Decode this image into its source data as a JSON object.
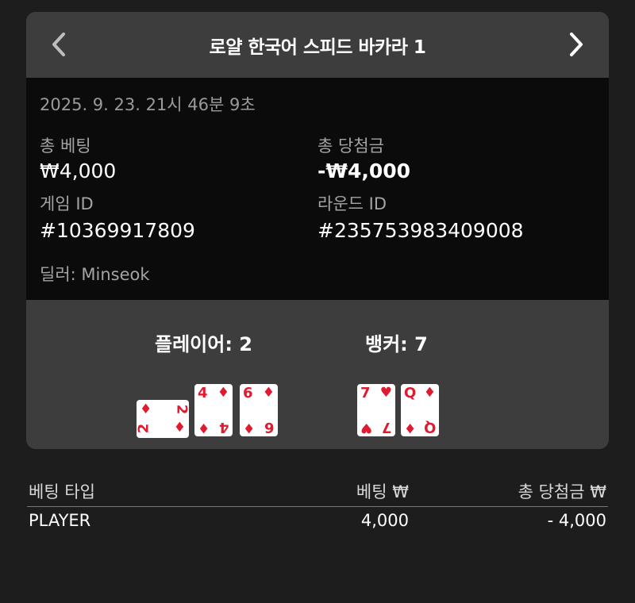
{
  "header": {
    "title": "로얄 한국어 스피드 바카라 1",
    "prev_icon": "chevron-left",
    "next_icon": "chevron-right"
  },
  "details": {
    "timestamp": "2025. 9. 23. 21시 46분 9초",
    "total_bet_label": "총 베팅",
    "total_bet_value": "₩4,000",
    "total_win_label": "총 당첨금",
    "total_win_value": "-₩4,000",
    "game_id_label": "게임 ID",
    "game_id_value": "#10369917809",
    "round_id_label": "라운드 ID",
    "round_id_value": "#235753983409008",
    "dealer": "딜러: Minseok"
  },
  "hands": {
    "player": {
      "label": "플레이어: 2",
      "cards": [
        {
          "rank": "2",
          "suit": "♦",
          "orientation": "sideways"
        },
        {
          "rank": "4",
          "suit": "♦",
          "orientation": "upright"
        },
        {
          "rank": "6",
          "suit": "♦",
          "orientation": "upright"
        }
      ]
    },
    "banker": {
      "label": "뱅커: 7",
      "cards": [
        {
          "rank": "7",
          "suit": "♥",
          "orientation": "upright"
        },
        {
          "rank": "Q",
          "suit": "♦",
          "orientation": "upright"
        }
      ]
    }
  },
  "bets_table": {
    "headers": [
      "베팅 타입",
      "베팅 ₩",
      "총 당첨금 ₩"
    ],
    "rows": [
      {
        "type": "PLAYER",
        "bet": "4,000",
        "win": "- 4,000"
      }
    ]
  },
  "colors": {
    "card_panel": "#3d3d3d",
    "info_panel": "#0b0b0b",
    "background": "#1d1d1d",
    "card_red": "#e01b2f"
  }
}
